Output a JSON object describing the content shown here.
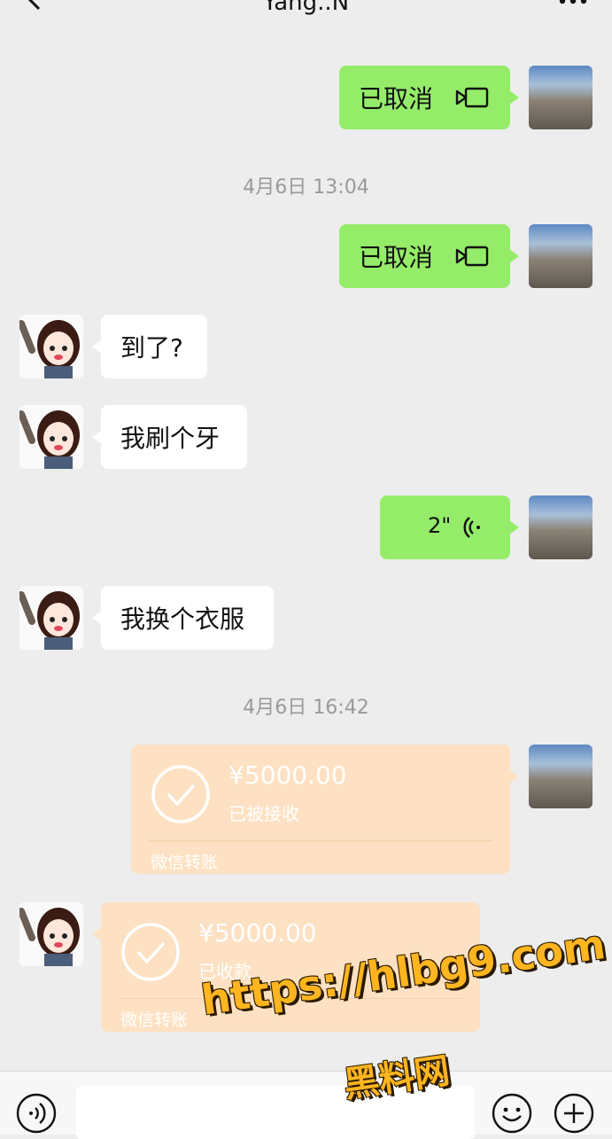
{
  "header": {
    "title": "Yang..N",
    "back_icon": "chevron-left-icon",
    "more_icon": "more-dots-icon"
  },
  "timestamps": [
    "4月6日 13:04",
    "4月6日 16:42"
  ],
  "messages": [
    {
      "side": "me",
      "type": "video_call",
      "text": "已取消",
      "icon": "video-camera-icon"
    },
    {
      "side": "me",
      "type": "video_call",
      "text": "已取消",
      "icon": "video-camera-icon"
    },
    {
      "side": "her",
      "type": "text",
      "text": "到了?"
    },
    {
      "side": "her",
      "type": "text",
      "text": "我刷个牙"
    },
    {
      "side": "me",
      "type": "voice",
      "duration": "2\"",
      "icon": "voice-wave-icon"
    },
    {
      "side": "her",
      "type": "text",
      "text": "我换个衣服"
    },
    {
      "side": "me",
      "type": "transfer",
      "amount": "¥5000.00",
      "status": "已被接收",
      "label": "微信转账"
    },
    {
      "side": "her",
      "type": "transfer",
      "amount": "¥5000.00",
      "status": "已收款",
      "label": "微信转账"
    }
  ],
  "input_bar": {
    "voice_icon": "voice-input-icon",
    "emoji_icon": "emoji-icon",
    "plus_icon": "plus-icon"
  },
  "watermark": {
    "url": "https://hlbg9.com",
    "cn": "黑料网"
  },
  "colors": {
    "background": "#ededed",
    "my_bubble": "#95ec69",
    "their_bubble": "#ffffff",
    "transfer": "#fde1c2",
    "watermark": "#ffb51f"
  }
}
